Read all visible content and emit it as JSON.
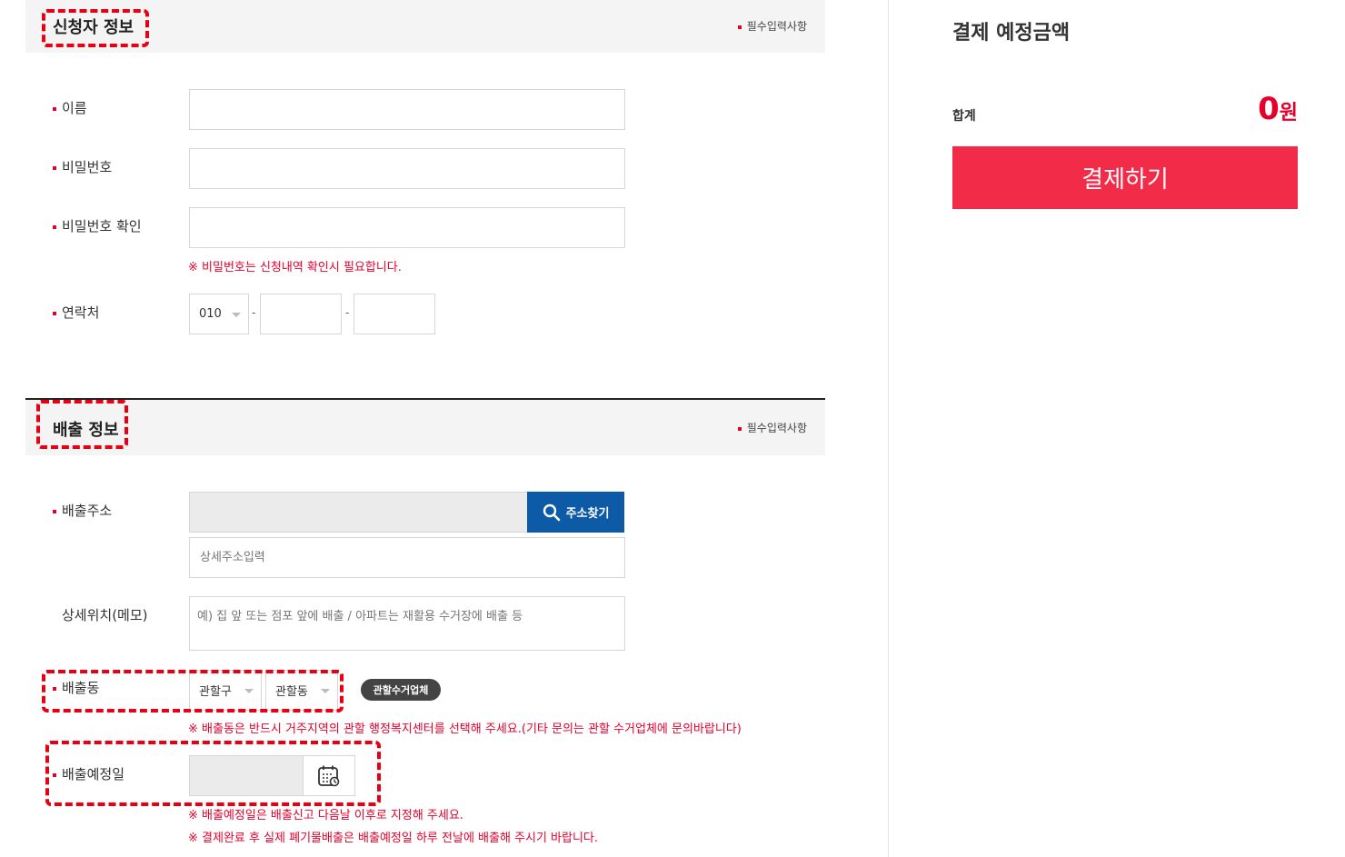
{
  "applicant": {
    "title": "신청자 정보",
    "required_note": "필수입력사항",
    "name_label": "이름",
    "password_label": "비밀번호",
    "password_confirm_label": "비밀번호 확인",
    "password_note": "※ 비밀번호는 신청내역 확인시 필요합니다.",
    "contact_label": "연락처",
    "phone_prefix": "010",
    "phone_sep1": "-",
    "phone_sep2": "-"
  },
  "disposal": {
    "title": "배출 정보",
    "required_note": "필수입력사항",
    "address_label": "배출주소",
    "address_button": "주소찾기",
    "detail_address_placeholder": "상세주소입력",
    "memo_label": "상세위치(메모)",
    "memo_placeholder": "예) 집 앞 또는 점포 앞에 배출 / 아파트는 재활용 수거장에 배출 등",
    "district_label": "배출동",
    "gu_select": "관할구",
    "dong_select": "관할동",
    "collector_button": "관할수거업체",
    "district_note": "※ 배출동은 반드시 거주지역의 관할 행정복지센터를 선택해 주세요.(기타 문의는 관할 수거업체에 문의바랍니다)",
    "date_label": "배출예정일",
    "date_note1": "※ 배출예정일은 배출신고 다음날 이후로 지정해 주세요.",
    "date_note2": "※ 결제완료 후 실제 폐기물배출은 배출예정일 하루 전날에 배출해 주시기 바랍니다."
  },
  "payment": {
    "title": "결제 예정금액",
    "sum_label": "합계",
    "amount": "0",
    "unit": "원",
    "pay_button": "결제하기"
  },
  "colors": {
    "accent_red": "#e4002b",
    "pay_button": "#f22b48",
    "address_button": "#0d5aa7"
  }
}
